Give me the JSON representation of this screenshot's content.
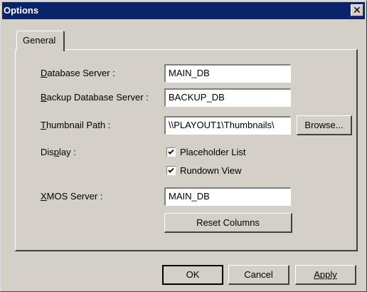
{
  "window": {
    "title": "Options",
    "close_glyph": "✕"
  },
  "tabs": [
    {
      "label": "General"
    }
  ],
  "fields": {
    "database_server": {
      "label_prefix": "",
      "label_hotkey": "D",
      "label_rest": "atabase Server :",
      "value": "MAIN_DB"
    },
    "backup_database_server": {
      "label_prefix": "",
      "label_hotkey": "B",
      "label_rest": "ackup Database Server :",
      "value": "BACKUP_DB"
    },
    "thumbnail_path": {
      "label_prefix": "",
      "label_hotkey": "T",
      "label_rest": "humbnail Path :",
      "value": "\\\\PLAYOUT1\\Thumbnails\\"
    },
    "xmos_server": {
      "label_prefix": "",
      "label_hotkey": "X",
      "label_rest": "MOS Server :",
      "value": "MAIN_DB"
    }
  },
  "display": {
    "label_prefix": "Dis",
    "label_hotkey": "p",
    "label_rest": "lay :",
    "options": [
      {
        "label": "Placeholder List",
        "checked": true
      },
      {
        "label": "Rundown View",
        "checked": true
      }
    ]
  },
  "buttons": {
    "browse": "Browse...",
    "reset_columns": "Reset Columns",
    "ok": "OK",
    "cancel": "Cancel",
    "apply": "Apply"
  }
}
